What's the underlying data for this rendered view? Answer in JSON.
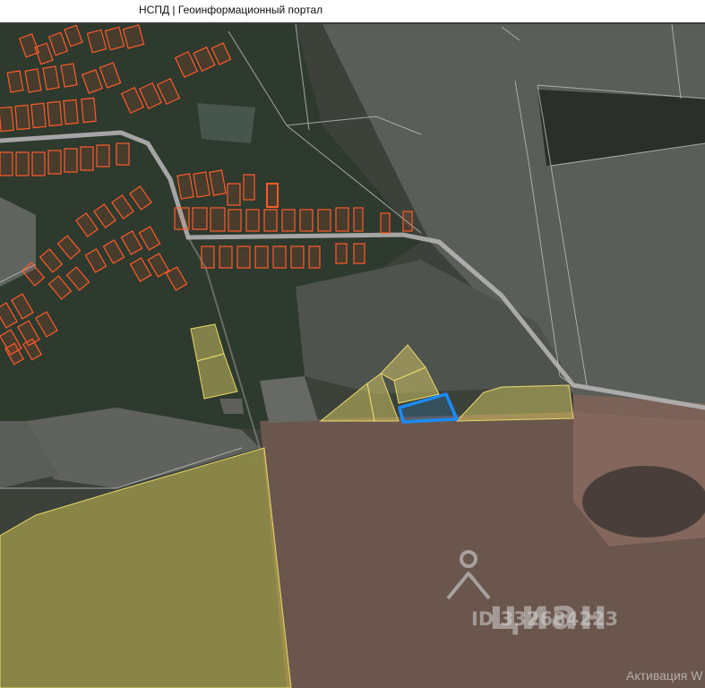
{
  "header": {
    "title": "НСПД | Геоинформационный портал"
  },
  "watermark": {
    "brand": "циан",
    "id_text": "ID 332684223"
  },
  "system_notice": {
    "text": "Активация W"
  },
  "colors": {
    "building_outline": "#ff5a2a",
    "parcel_fill": "#e8d96a",
    "selected_parcel": "#1a8cff",
    "road": "#b9b9b9"
  }
}
